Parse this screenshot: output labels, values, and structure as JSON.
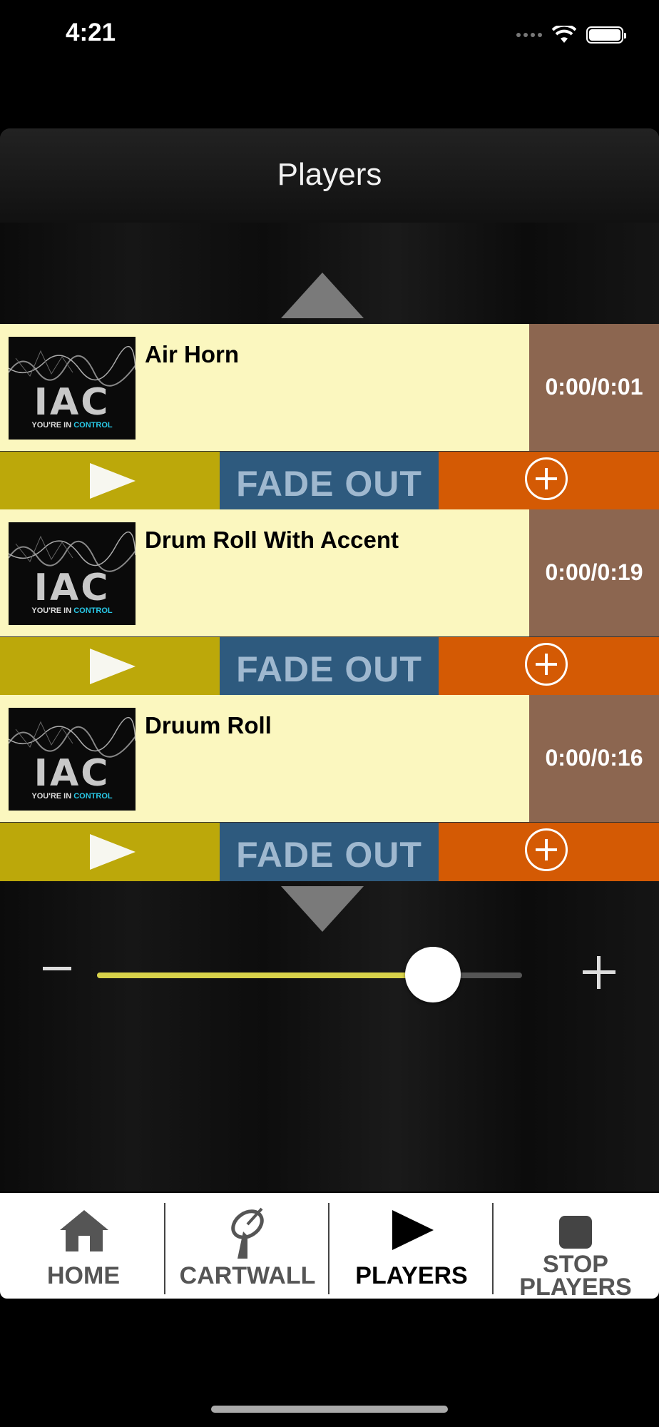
{
  "status_bar": {
    "time": "4:21"
  },
  "header": {
    "title": "Players"
  },
  "players": [
    {
      "name": "Air Horn",
      "time": "0:00/0:01",
      "fade_label": "FADE OUT",
      "logo_text": "IAC",
      "logo_tag_1": "YOU'RE IN",
      "logo_tag_2": "CONTROL"
    },
    {
      "name": "Drum Roll With Accent",
      "time": "0:00/0:19",
      "fade_label": "FADE OUT",
      "logo_text": "IAC",
      "logo_tag_1": "YOU'RE IN",
      "logo_tag_2": "CONTROL"
    },
    {
      "name": "Druum Roll",
      "time": "0:00/0:16",
      "fade_label": "FADE OUT",
      "logo_text": "IAC",
      "logo_tag_1": "YOU'RE IN",
      "logo_tag_2": "CONTROL"
    }
  ],
  "volume": {
    "level_fraction": 0.79
  },
  "tabs": [
    {
      "label": "HOME",
      "icon": "home-icon",
      "active": false
    },
    {
      "label": "CARTWALL",
      "icon": "satellite-dish-icon",
      "active": false
    },
    {
      "label": "PLAYERS",
      "icon": "play-icon",
      "active": true
    },
    {
      "label": "STOP\nPLAYERS",
      "label_line1": "STOP",
      "label_line2": "PLAYERS",
      "icon": "stop-icon",
      "active": false
    }
  ],
  "colors": {
    "track_bg": "#fbf7bf",
    "time_bg": "#8c6650",
    "play_bg": "#bca80a",
    "fade_bg": "#2e5a7e",
    "add_bg": "#d45a04",
    "volume_fill": "#d8d24a"
  }
}
